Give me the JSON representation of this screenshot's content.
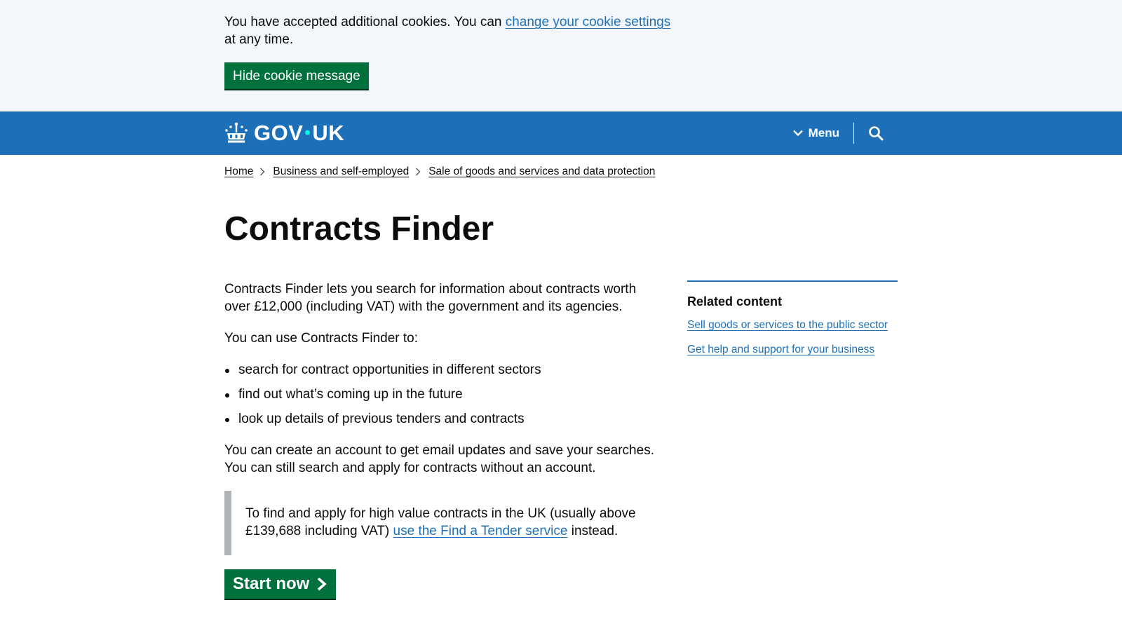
{
  "cookie_banner": {
    "text_before": "You have accepted additional cookies. You can ",
    "link_text": "change your cookie settings",
    "text_after": " at any time.",
    "hide_button": "Hide cookie message"
  },
  "header": {
    "logo_text_left": "GOV",
    "logo_dot": "•",
    "logo_text_right": "UK",
    "menu_label": "Menu",
    "colors": {
      "background": "#1d70b8",
      "logo_dot": "#00ffe0"
    }
  },
  "breadcrumb": {
    "items": [
      {
        "label": "Home"
      },
      {
        "label": "Business and self-employed"
      },
      {
        "label": "Sale of goods and services and data protection"
      }
    ]
  },
  "main": {
    "title": "Contracts Finder",
    "intro": "Contracts Finder lets you search for information about contracts worth over £12,000 (including VAT) with the government and its agencies.",
    "use_intro": "You can use Contracts Finder to:",
    "bullets": [
      "search for contract opportunities in different sectors",
      "find out what’s coming up in the future",
      "look up details of previous tenders and contracts"
    ],
    "account_text": "You can create an account to get email updates and save your searches. You can still search and apply for contracts without an account.",
    "inset": {
      "text_before": "To find and apply for high value contracts in the UK (usually above £139,688 including VAT) ",
      "link_text": "use the Find a Tender service",
      "text_after": " instead."
    },
    "start_button": "Start now",
    "colors": {
      "button": "#00703c",
      "link": "#1d70b8"
    }
  },
  "related": {
    "heading": "Related content",
    "links": [
      "Sell goods or services to the public sector",
      "Get help and support for your business"
    ]
  }
}
